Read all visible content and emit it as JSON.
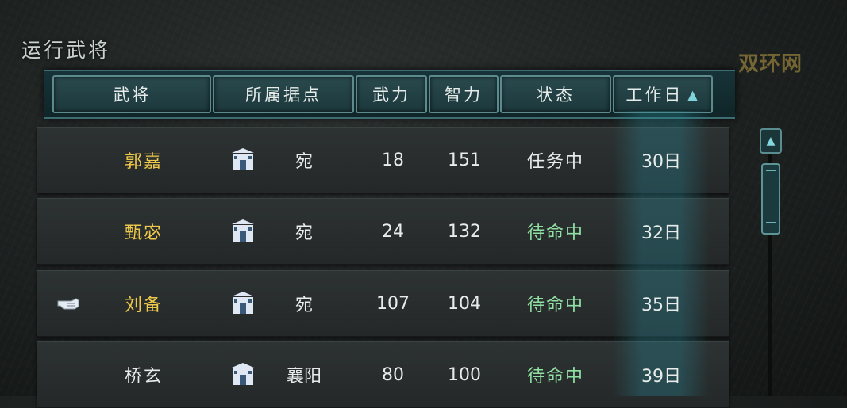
{
  "panel": {
    "title": "运行武将"
  },
  "watermark": "双环网",
  "columns": {
    "general": "武将",
    "base": "所属据点",
    "war": "武力",
    "intel": "智力",
    "status": "状态",
    "workday": "工作日",
    "sort_icon": "triangle-up-icon"
  },
  "rows": [
    {
      "name": "郭嘉",
      "base": "宛",
      "war": "18",
      "intel": "151",
      "status": "任务中",
      "workday": "30日",
      "status_type": "busy",
      "leader": false
    },
    {
      "name": "甄宓",
      "base": "宛",
      "war": "24",
      "intel": "132",
      "status": "待命中",
      "workday": "32日",
      "status_type": "idle",
      "leader": false
    },
    {
      "name": "刘备",
      "base": "宛",
      "war": "107",
      "intel": "104",
      "status": "待命中",
      "workday": "35日",
      "status_type": "idle",
      "leader": true
    },
    {
      "name": "桥玄",
      "base": "襄阳",
      "war": "80",
      "intel": "100",
      "status": "待命中",
      "workday": "39日",
      "status_type": "idle",
      "leader": false
    }
  ],
  "colors": {
    "name": "#efc94b",
    "status_busy": "#e9eeec",
    "status_idle": "#8fe0a2",
    "accent": "#5d8a8d"
  },
  "icons": {
    "city": "city-gate-icon",
    "leader": "pointing-hand-icon",
    "scroll_up": "scroll-up-arrow-icon"
  }
}
